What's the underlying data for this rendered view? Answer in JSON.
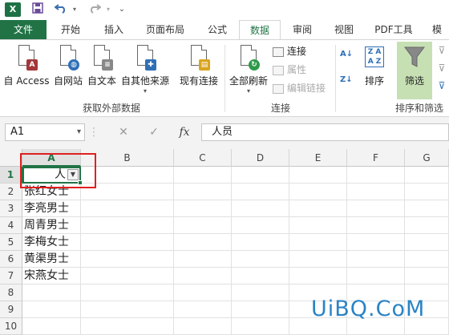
{
  "quick_access": {
    "app_icon": "X",
    "save_icon": "save-icon",
    "undo_icon": "undo-icon",
    "redo_icon": "redo-icon",
    "customize_icon": "customize-qat-icon"
  },
  "tabs": [
    {
      "label": "文件",
      "state": "file"
    },
    {
      "label": "开始"
    },
    {
      "label": "插入"
    },
    {
      "label": "页面布局"
    },
    {
      "label": "公式"
    },
    {
      "label": "数据",
      "state": "active"
    },
    {
      "label": "审阅"
    },
    {
      "label": "视图"
    },
    {
      "label": "PDF工具"
    },
    {
      "label": "模"
    }
  ],
  "ribbon": {
    "external_data": {
      "group_label": "获取外部数据",
      "buttons": [
        "自 Access",
        "自网站",
        "自文本",
        "自其他来源",
        "现有连接"
      ]
    },
    "connections": {
      "group_label": "连接",
      "refresh_all": "全部刷新",
      "connect": "连接",
      "properties": "属性",
      "edit_links": "编辑链接"
    },
    "sort_filter": {
      "group_label": "排序和筛选",
      "sort": "排序",
      "filter": "筛选",
      "sort_az_icon": "sort-ascending-icon",
      "sort_za_icon": "sort-descending-icon"
    }
  },
  "formula_bar": {
    "name_box": "A1",
    "cancel_icon": "✕",
    "enter_icon": "✓",
    "fx_label": "fx",
    "content": "人员"
  },
  "sheet": {
    "columns": [
      "A",
      "B",
      "C",
      "D",
      "E",
      "F",
      "G"
    ],
    "rows": [
      "1",
      "2",
      "3",
      "4",
      "5",
      "6",
      "7",
      "8",
      "9",
      "10"
    ],
    "header_cell": "人",
    "cells": [
      "张红女士",
      "李亮男士",
      "周青男士",
      "李梅女士",
      "黄渠男士",
      "宋燕女士"
    ]
  },
  "watermark": "UiBQ.CoM",
  "colors": {
    "accent": "#217346",
    "highlight": "#e02020",
    "filter_active": "#c6e0b4"
  }
}
